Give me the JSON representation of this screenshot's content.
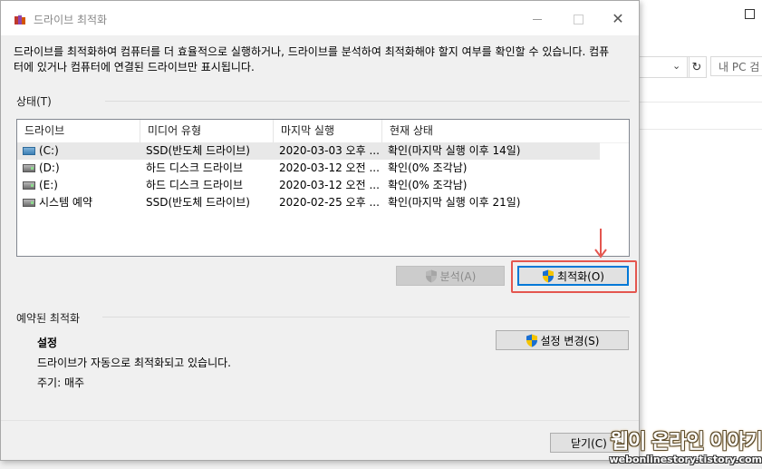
{
  "window": {
    "title": "드라이브 최적화",
    "description": "드라이브를 최적화하여 컴퓨터를 더 효율적으로 실행하거나, 드라이브를 분석하여 최적화해야 할지 여부를 확인할 수 있습니다. 컴퓨터에 있거나 컴퓨터에 연결된 드라이브만 표시됩니다."
  },
  "status": {
    "label": "상태(T)",
    "columns": [
      "드라이브",
      "미디어 유형",
      "마지막 실행",
      "현재 상태"
    ],
    "rows": [
      {
        "drive": "(C:)",
        "icon": "ssd-drive-icon",
        "media": "SSD(반도체 드라이브)",
        "last_run": "2020-03-03 오후 ...",
        "state": "확인(마지막 실행 이후 14일)"
      },
      {
        "drive": "(D:)",
        "icon": "hdd-drive-icon",
        "media": "하드 디스크 드라이브",
        "last_run": "2020-03-12 오전 ...",
        "state": "확인(0% 조각남)"
      },
      {
        "drive": "(E:)",
        "icon": "hdd-drive-icon",
        "media": "하드 디스크 드라이브",
        "last_run": "2020-03-12 오전 ...",
        "state": "확인(0% 조각남)"
      },
      {
        "drive": "시스템 예약",
        "icon": "hdd-drive-icon",
        "media": "SSD(반도체 드라이브)",
        "last_run": "2020-02-25 오후 ...",
        "state": "확인(마지막 실행 이후 21일)"
      }
    ]
  },
  "actions": {
    "analyze_label": "분석(A)",
    "optimize_label": "최적화(O)"
  },
  "schedule": {
    "label": "예약된 최적화",
    "settings_title": "설정",
    "auto_text": "드라이브가 자동으로 최적화되고 있습니다.",
    "frequency": "주기: 매주",
    "change_settings_label": "설정 변경(S)"
  },
  "footer": {
    "close_label": "닫기(C)"
  },
  "background": {
    "search_placeholder": "내 PC 검"
  },
  "watermark": {
    "main": "웹이 온라인 이야기",
    "sub": "webonlinestory.tistory.com"
  },
  "colors": {
    "highlight": "#e4564f",
    "default_button_border": "#0078d7",
    "selected_row": "#e8e8e8"
  }
}
